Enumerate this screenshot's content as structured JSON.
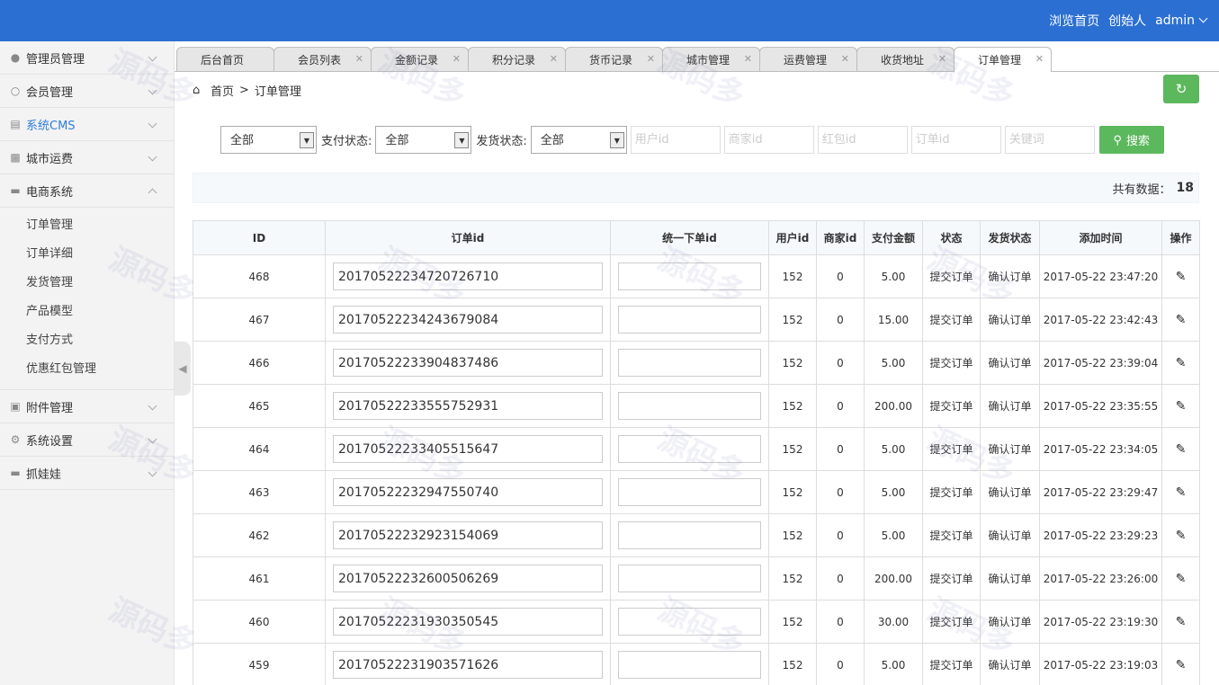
{
  "header": {
    "browse_home": "浏览首页",
    "role": "创始人",
    "user": "admin"
  },
  "sidebar": {
    "items": [
      {
        "label": "管理员管理",
        "icon": "user-icon"
      },
      {
        "label": "会员管理",
        "icon": "member-icon"
      },
      {
        "label": "系统CMS",
        "icon": "cms-icon"
      },
      {
        "label": "城市运费",
        "icon": "truck-icon"
      },
      {
        "label": "电商系统",
        "icon": "shop-icon"
      }
    ],
    "sub_items": [
      "订单管理",
      "订单详细",
      "发货管理",
      "产品模型",
      "支付方式",
      "优惠红包管理"
    ],
    "bottom_items": [
      {
        "label": "附件管理",
        "icon": "image-icon"
      },
      {
        "label": "系统设置",
        "icon": "gear-icon"
      },
      {
        "label": "抓娃娃",
        "icon": "game-icon"
      }
    ]
  },
  "tabs": [
    "后台首页",
    "会员列表",
    "金额记录",
    "积分记录",
    "货币记录",
    "城市管理",
    "运费管理",
    "收货地址",
    "订单管理"
  ],
  "breadcrumb": {
    "home": "首页",
    "sep": ">",
    "current": "订单管理"
  },
  "filters": {
    "first_select": "全部",
    "pay_label": "支付状态:",
    "pay_select": "全部",
    "ship_label": "发货状态:",
    "ship_select": "全部",
    "placeholders": [
      "用户id",
      "商家id",
      "红包id",
      "订单id",
      "关键词"
    ],
    "search_label": "搜索"
  },
  "count": {
    "label": "共有数据：",
    "value": "18"
  },
  "table": {
    "headers": [
      "ID",
      "订单id",
      "统一下单id",
      "用户id",
      "商家id",
      "支付金额",
      "状态",
      "发货状态",
      "添加时间",
      "操作"
    ],
    "rows": [
      {
        "id": "468",
        "order_id": "20170522234720726710",
        "unified_id": "",
        "user_id": "152",
        "merchant_id": "0",
        "amount": "5.00",
        "status": "提交订单",
        "ship_status": "确认订单",
        "time": "2017-05-22 23:47:20"
      },
      {
        "id": "467",
        "order_id": "20170522234243679084",
        "unified_id": "",
        "user_id": "152",
        "merchant_id": "0",
        "amount": "15.00",
        "status": "提交订单",
        "ship_status": "确认订单",
        "time": "2017-05-22 23:42:43"
      },
      {
        "id": "466",
        "order_id": "20170522233904837486",
        "unified_id": "",
        "user_id": "152",
        "merchant_id": "0",
        "amount": "5.00",
        "status": "提交订单",
        "ship_status": "确认订单",
        "time": "2017-05-22 23:39:04"
      },
      {
        "id": "465",
        "order_id": "20170522233555752931",
        "unified_id": "",
        "user_id": "152",
        "merchant_id": "0",
        "amount": "200.00",
        "status": "提交订单",
        "ship_status": "确认订单",
        "time": "2017-05-22 23:35:55"
      },
      {
        "id": "464",
        "order_id": "20170522233405515647",
        "unified_id": "",
        "user_id": "152",
        "merchant_id": "0",
        "amount": "5.00",
        "status": "提交订单",
        "ship_status": "确认订单",
        "time": "2017-05-22 23:34:05"
      },
      {
        "id": "463",
        "order_id": "20170522232947550740",
        "unified_id": "",
        "user_id": "152",
        "merchant_id": "0",
        "amount": "5.00",
        "status": "提交订单",
        "ship_status": "确认订单",
        "time": "2017-05-22 23:29:47"
      },
      {
        "id": "462",
        "order_id": "20170522232923154069",
        "unified_id": "",
        "user_id": "152",
        "merchant_id": "0",
        "amount": "5.00",
        "status": "提交订单",
        "ship_status": "确认订单",
        "time": "2017-05-22 23:29:23"
      },
      {
        "id": "461",
        "order_id": "20170522232600506269",
        "unified_id": "",
        "user_id": "152",
        "merchant_id": "0",
        "amount": "200.00",
        "status": "提交订单",
        "ship_status": "确认订单",
        "time": "2017-05-22 23:26:00"
      },
      {
        "id": "460",
        "order_id": "20170522231930350545",
        "unified_id": "",
        "user_id": "152",
        "merchant_id": "0",
        "amount": "30.00",
        "status": "提交订单",
        "ship_status": "确认订单",
        "time": "2017-05-22 23:19:30"
      },
      {
        "id": "459",
        "order_id": "20170522231903571626",
        "unified_id": "",
        "user_id": "152",
        "merchant_id": "0",
        "amount": "5.00",
        "status": "提交订单",
        "ship_status": "确认订单",
        "time": "2017-05-22 23:19:03"
      }
    ]
  },
  "colors": {
    "topbar": "#2b6fd2",
    "green": "#5cb85c",
    "link_blue": "#1a1ae0",
    "pink": "#f2b0c8"
  },
  "watermark": {
    "text": "源码多"
  }
}
